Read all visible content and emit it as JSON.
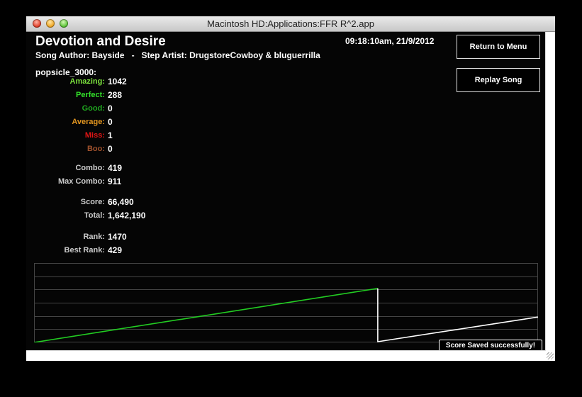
{
  "window": {
    "title": "Macintosh HD:Applications:FFR R^2.app"
  },
  "song": {
    "title": "Devotion and Desire",
    "author_line": "Song Author: Bayside   -   Step Artist: DrugstoreCowboy & bluguerrilla",
    "timestamp": "09:18:10am, 21/9/2012"
  },
  "buttons": {
    "return_label": "Return to Menu",
    "replay_label": "Replay Song"
  },
  "player": "popsicle_3000:",
  "judgements": [
    {
      "label": "Amazing:",
      "value": "1042",
      "color": "#7be03c"
    },
    {
      "label": "Perfect:",
      "value": "288",
      "color": "#33e02a"
    },
    {
      "label": "Good:",
      "value": "0",
      "color": "#1fa51f"
    },
    {
      "label": "Average:",
      "value": "0",
      "color": "#e0941f"
    },
    {
      "label": "Miss:",
      "value": "1",
      "color": "#e01515"
    },
    {
      "label": "Boo:",
      "value": "0",
      "color": "#a0522d"
    }
  ],
  "combo": [
    {
      "label": "Combo:",
      "value": "419",
      "color": "#cccccc"
    },
    {
      "label": "Max Combo:",
      "value": "911",
      "color": "#cccccc"
    }
  ],
  "score": [
    {
      "label": "Score:",
      "value": "66,490",
      "color": "#cccccc"
    },
    {
      "label": "Total:",
      "value": "1,642,190",
      "color": "#cccccc"
    }
  ],
  "rank": [
    {
      "label": "Rank:",
      "value": "1470",
      "color": "#cccccc"
    },
    {
      "label": "Best Rank:",
      "value": "429",
      "color": "#cccccc"
    }
  ],
  "graph": {
    "green_series": {
      "color": "#22cc22",
      "start_level": 0.0,
      "end_level": 0.68,
      "end_fraction": 0.682
    },
    "white_series": {
      "color": "#ffffff",
      "drop_level": 0.0,
      "end_level": 0.32
    },
    "gridline_count": 6,
    "grid_color": "#444444"
  },
  "toast": "Score Saved successfully!"
}
